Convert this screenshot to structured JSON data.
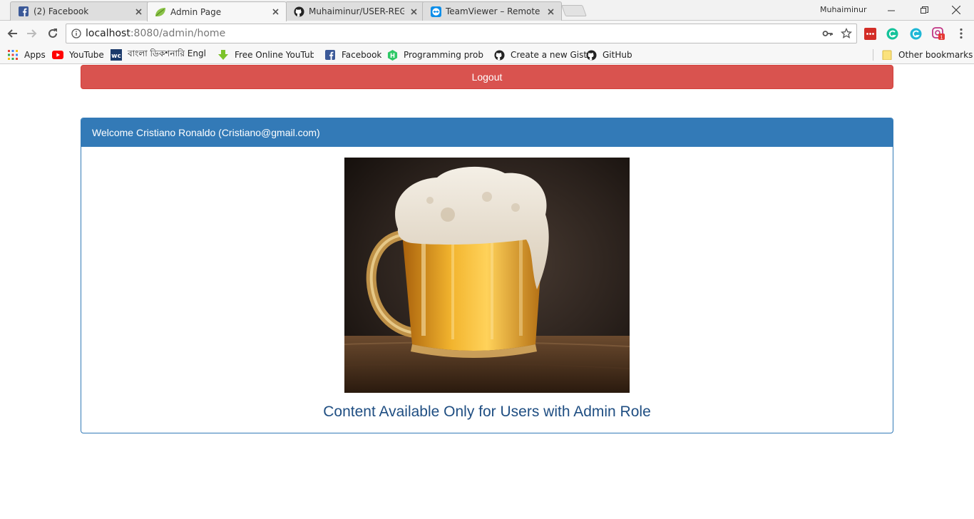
{
  "browser": {
    "tabs": [
      {
        "title": "(2) Facebook",
        "icon": "facebook-icon",
        "active": false
      },
      {
        "title": "Admin Page",
        "icon": "spring-leaf-icon",
        "active": true
      },
      {
        "title": "Muhaiminur/USER-REGIS",
        "icon": "github-icon",
        "active": false
      },
      {
        "title": "TeamViewer – Remote Su",
        "icon": "teamviewer-icon",
        "active": false
      }
    ],
    "profile_name": "Muhaiminur",
    "url_host": "localhost",
    "url_rest": ":8080/admin/home",
    "bookmarks": [
      {
        "label": "Apps",
        "icon": "apps-grid-icon"
      },
      {
        "label": "YouTube",
        "icon": "youtube-icon"
      },
      {
        "label": "বাংলা ডিকশনারি Engl",
        "icon": "wc-icon"
      },
      {
        "label": "Free Online YouTube",
        "icon": "download-arrow-icon"
      },
      {
        "label": "Facebook",
        "icon": "facebook-icon"
      },
      {
        "label": "Programming proble",
        "icon": "hackerrank-icon"
      },
      {
        "label": "Create a new Gist",
        "icon": "github-icon"
      },
      {
        "label": "GitHub",
        "icon": "github-icon"
      }
    ],
    "other_bookmarks": "Other bookmarks",
    "extension_badge": "1"
  },
  "page": {
    "logout_label": "Logout",
    "panel_heading": "Welcome Cristiano Ronaldo (Cristiano@gmail.com)",
    "caption": "Content Available Only for Users with Admin Role",
    "image_subject": "beer-mug-image"
  },
  "colors": {
    "danger": "#d9534f",
    "primary": "#337ab7",
    "caption": "#1f4e82"
  }
}
